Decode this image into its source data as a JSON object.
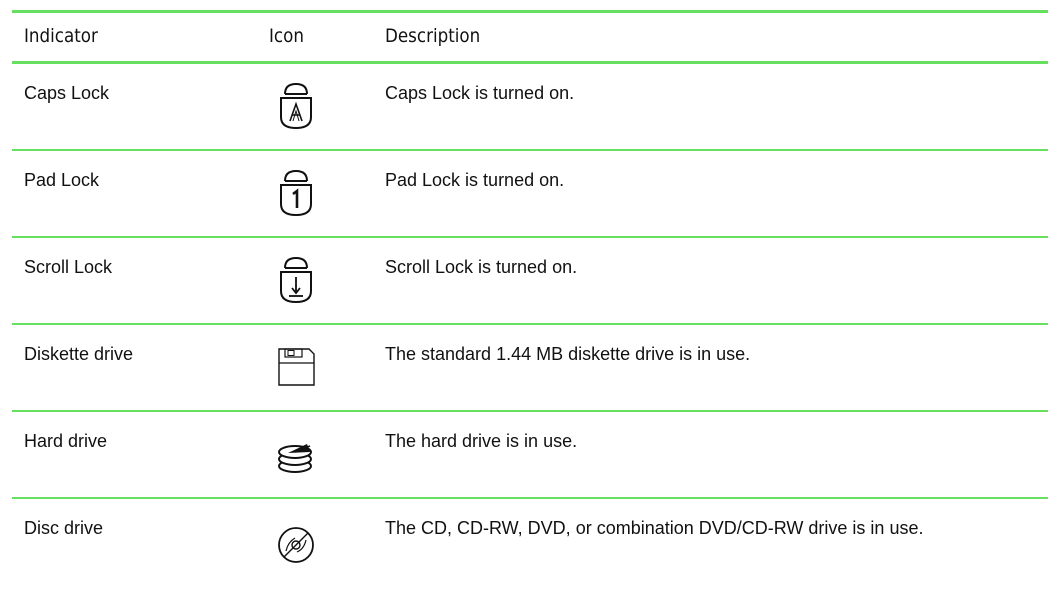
{
  "table": {
    "headers": {
      "indicator": "Indicator",
      "icon": "Icon",
      "description": "Description"
    },
    "rows": [
      {
        "indicator": "Caps Lock",
        "icon": "caps-lock-icon",
        "description": "Caps Lock is turned on."
      },
      {
        "indicator": "Pad Lock",
        "icon": "pad-lock-icon",
        "description": "Pad Lock is turned on."
      },
      {
        "indicator": "Scroll Lock",
        "icon": "scroll-lock-icon",
        "description": "Scroll Lock is turned on."
      },
      {
        "indicator": "Diskette drive",
        "icon": "diskette-drive-icon",
        "description": "The standard 1.44 MB diskette drive is in use."
      },
      {
        "indicator": "Hard drive",
        "icon": "hard-drive-icon",
        "description": "The hard drive is in use."
      },
      {
        "indicator": "Disc drive",
        "icon": "disc-drive-icon",
        "description": "The CD, CD-RW, DVD, or combination DVD/CD-RW drive is in use."
      }
    ]
  },
  "colors": {
    "rule": "#66e05e",
    "text": "#111111"
  }
}
